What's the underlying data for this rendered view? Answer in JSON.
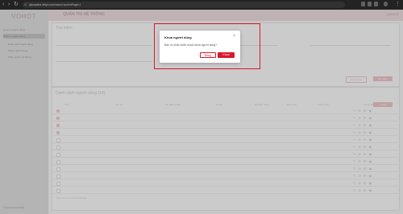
{
  "browser": {
    "url": "qlsuaptest.vietpn.com/users?currentPage=1"
  },
  "sidebar": {
    "logo": "VOHOT",
    "items": [
      {
        "label": "Quản lý người dùng",
        "active": false
      },
      {
        "label": "Quản lý người dùng",
        "active": true
      },
      {
        "label": "Danh sách người dùng",
        "active": false
      },
      {
        "label": "Nhóm người dùng",
        "active": false
      },
      {
        "label": "Phân quyền hệ thống",
        "active": false
      }
    ],
    "footer": "© Quản trị hệ thống"
  },
  "header": {
    "title": "QUẢN TRỊ HỆ THỐNG",
    "user": "Admin ▾"
  },
  "search_panel": {
    "title": "Tìm kiếm",
    "clear_label": "Xóa bộ lọc",
    "search_label": "Tìm kiếm"
  },
  "list_panel": {
    "title": "Danh sách người dùng (18)",
    "add_label": "+ Thêm",
    "columns": [
      "STT",
      "Họ tên",
      "Tên đăng nhập",
      "Email",
      "Số điện thoại",
      "Ngày tạo",
      "Trạng thái",
      "Hành động"
    ],
    "footer": "Hiển thị 1-10 của 18 kết quả"
  },
  "modal": {
    "title": "Khoá người dùng",
    "body": "Bạn có chắc chắn muốn khoá người dùng?",
    "cancel_label": "Đóng",
    "confirm_label": "Khoá"
  }
}
